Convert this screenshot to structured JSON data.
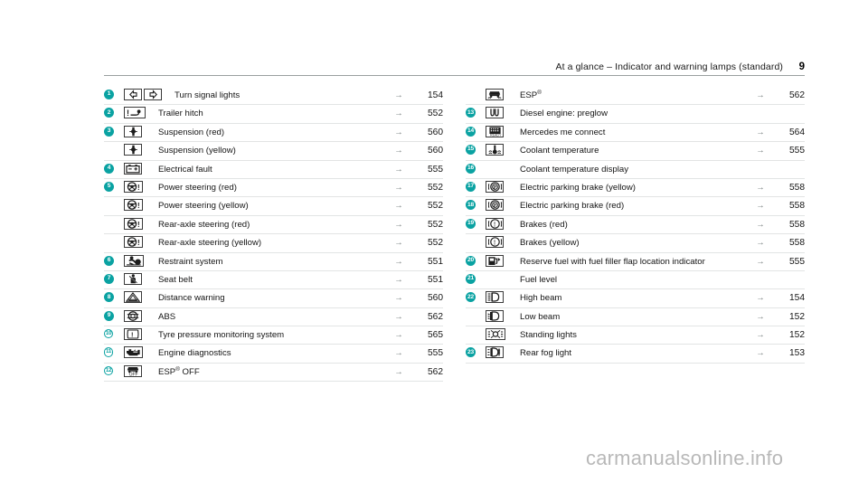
{
  "header": {
    "title": "At a glance – Indicator and warning lamps (standard)",
    "page_number": "9"
  },
  "watermark": "carmanualsonline.info",
  "arrow_glyph": "→",
  "accent_color": "#0aa2a2",
  "columns": [
    {
      "id": "left",
      "rows": [
        {
          "badge": "1",
          "badge_style": "filled",
          "icon": "turn-signal-lights",
          "label": "Turn signal lights",
          "arrow": "→",
          "page": "154"
        },
        {
          "badge": "2",
          "badge_style": "filled",
          "icon": "trailer-hitch",
          "label": "Trailer hitch",
          "arrow": "→",
          "page": "552"
        },
        {
          "badge": "3",
          "badge_style": "filled",
          "icon": "suspension",
          "label": "Suspension (red)",
          "arrow": "→",
          "page": "560"
        },
        {
          "badge": "",
          "badge_style": "none",
          "icon": "suspension",
          "label": "Suspension (yellow)",
          "arrow": "→",
          "page": "560"
        },
        {
          "badge": "4",
          "badge_style": "filled",
          "icon": "electrical-fault",
          "label": "Electrical fault",
          "arrow": "→",
          "page": "555"
        },
        {
          "badge": "5",
          "badge_style": "filled",
          "icon": "power-steering",
          "label": "Power steering (red)",
          "arrow": "→",
          "page": "552"
        },
        {
          "badge": "",
          "badge_style": "none",
          "icon": "power-steering",
          "label": "Power steering (yellow)",
          "arrow": "→",
          "page": "552"
        },
        {
          "badge": "",
          "badge_style": "none",
          "icon": "power-steering",
          "label": "Rear-axle steering (red)",
          "arrow": "→",
          "page": "552"
        },
        {
          "badge": "",
          "badge_style": "none",
          "icon": "power-steering",
          "label": "Rear-axle steering (yellow)",
          "arrow": "→",
          "page": "552"
        },
        {
          "badge": "6",
          "badge_style": "filled",
          "icon": "restraint-system",
          "label": "Restraint system",
          "arrow": "→",
          "page": "551"
        },
        {
          "badge": "7",
          "badge_style": "filled",
          "icon": "seat-belt",
          "label": "Seat belt",
          "arrow": "→",
          "page": "551"
        },
        {
          "badge": "8",
          "badge_style": "filled",
          "icon": "distance-warning",
          "label": "Distance warning",
          "arrow": "→",
          "page": "560"
        },
        {
          "badge": "9",
          "badge_style": "filled",
          "icon": "abs",
          "label": "ABS",
          "arrow": "→",
          "page": "562"
        },
        {
          "badge": "10",
          "badge_style": "hollow",
          "icon": "tyre-pressure",
          "label": "Tyre pressure monitoring system",
          "arrow": "→",
          "page": "565"
        },
        {
          "badge": "11",
          "badge_style": "hollow",
          "icon": "engine-diagnostics",
          "label": "Engine diagnostics",
          "arrow": "→",
          "page": "555"
        },
        {
          "badge": "12",
          "badge_style": "hollow",
          "icon": "esp-off",
          "label": "ESP® OFF",
          "label_sup": "®",
          "label_pre": "ESP",
          "label_post": " OFF",
          "arrow": "→",
          "page": "562"
        }
      ]
    },
    {
      "id": "right",
      "rows": [
        {
          "badge": "",
          "badge_style": "none",
          "icon": "esp",
          "label": "ESP®",
          "label_pre": "ESP",
          "label_sup": "®",
          "label_post": "",
          "arrow": "→",
          "page": "562"
        },
        {
          "badge": "13",
          "badge_style": "filled",
          "icon": "diesel-preglow",
          "label": "Diesel engine: preglow",
          "arrow": "",
          "page": ""
        },
        {
          "badge": "14",
          "badge_style": "filled",
          "icon": "mercedes-me-connect",
          "label": "Mercedes me connect",
          "arrow": "→",
          "page": "564"
        },
        {
          "badge": "15",
          "badge_style": "filled",
          "icon": "coolant-temperature",
          "label": "Coolant temperature",
          "arrow": "→",
          "page": "555"
        },
        {
          "badge": "16",
          "badge_style": "filled",
          "icon": "",
          "label": "Coolant temperature display",
          "arrow": "",
          "page": ""
        },
        {
          "badge": "17",
          "badge_style": "filled",
          "icon": "electric-parking-brake",
          "label": "Electric parking brake (yellow)",
          "arrow": "→",
          "page": "558"
        },
        {
          "badge": "18",
          "badge_style": "filled",
          "icon": "electric-parking-brake",
          "label": "Electric parking brake (red)",
          "arrow": "→",
          "page": "558"
        },
        {
          "badge": "19",
          "badge_style": "filled",
          "icon": "brakes",
          "label": "Brakes (red)",
          "arrow": "→",
          "page": "558"
        },
        {
          "badge": "",
          "badge_style": "none",
          "icon": "brakes",
          "label": "Brakes (yellow)",
          "arrow": "→",
          "page": "558"
        },
        {
          "badge": "20",
          "badge_style": "filled",
          "icon": "reserve-fuel",
          "label": "Reserve fuel with fuel filler flap location indicator",
          "arrow": "→",
          "page": "555"
        },
        {
          "badge": "21",
          "badge_style": "filled",
          "icon": "",
          "label": "Fuel level",
          "arrow": "",
          "page": ""
        },
        {
          "badge": "22",
          "badge_style": "filled",
          "icon": "high-beam",
          "label": "High beam",
          "arrow": "→",
          "page": "154"
        },
        {
          "badge": "",
          "badge_style": "none",
          "icon": "low-beam",
          "label": "Low beam",
          "arrow": "→",
          "page": "152"
        },
        {
          "badge": "",
          "badge_style": "none",
          "icon": "standing-lights",
          "label": "Standing lights",
          "arrow": "→",
          "page": "152"
        },
        {
          "badge": "23",
          "badge_style": "filled",
          "icon": "rear-fog-light",
          "label": "Rear fog light",
          "arrow": "→",
          "page": "153"
        }
      ]
    }
  ]
}
